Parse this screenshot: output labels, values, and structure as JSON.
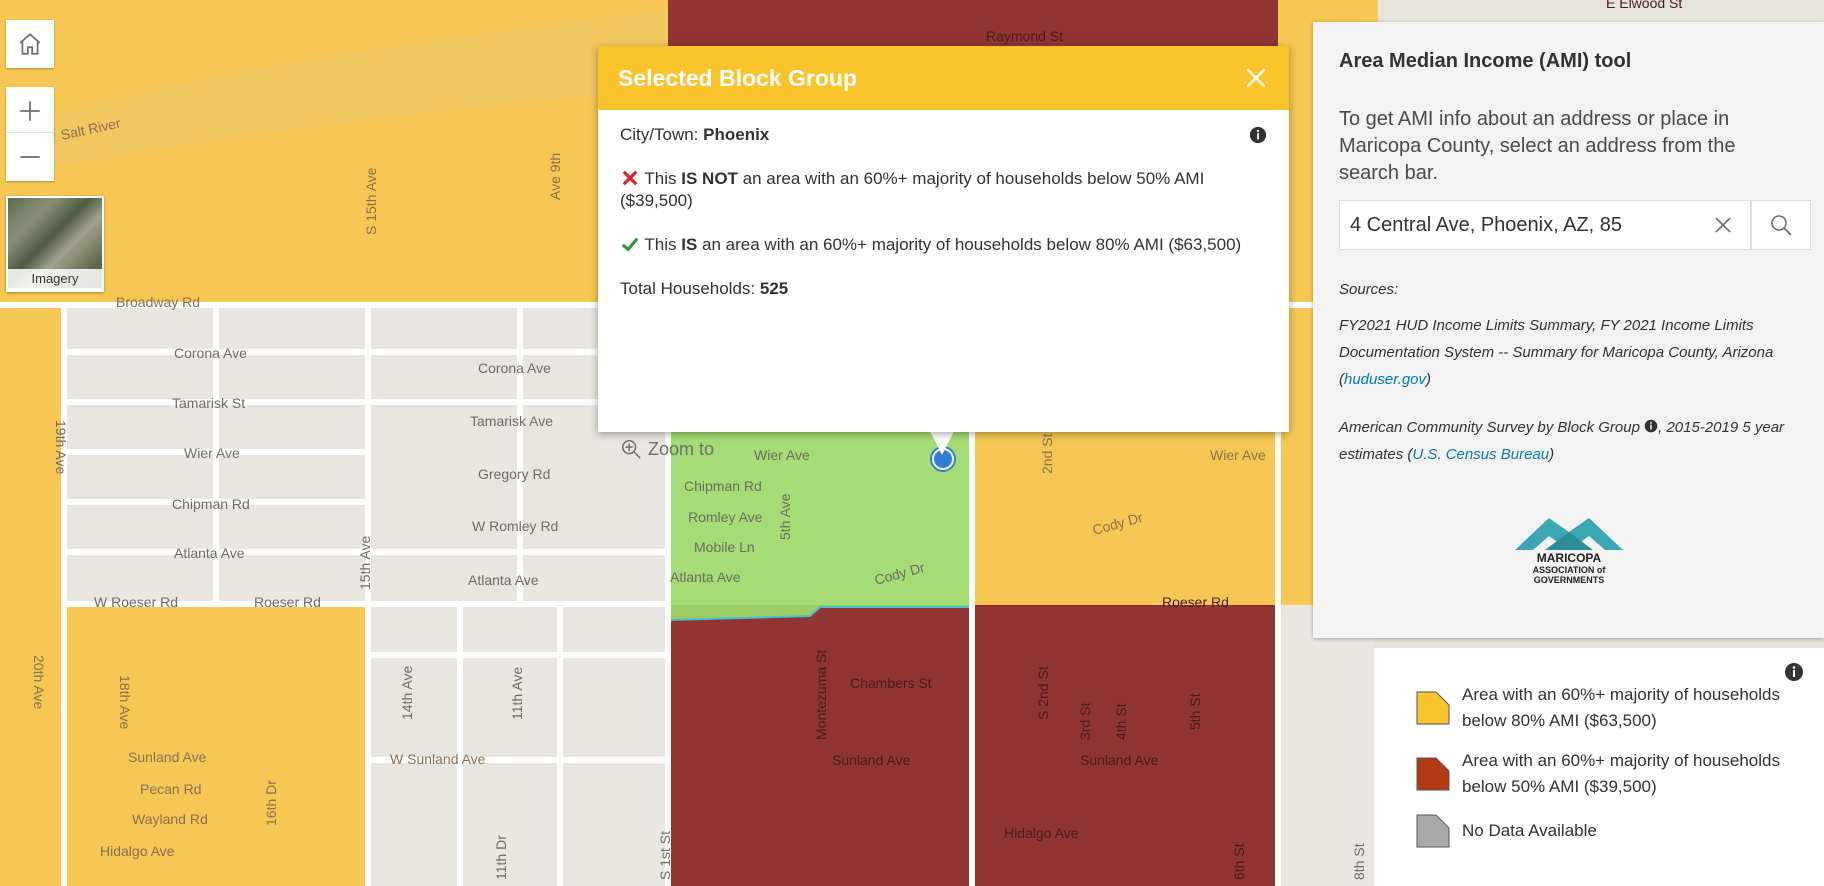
{
  "map": {
    "colors": {
      "yellow": "#f7c646",
      "red": "#8b2a2a",
      "green": "#9fdc6a",
      "road": "#ffffff",
      "base": "#e6e3de"
    },
    "street_labels": [
      "Salt River",
      "S 15th Ave",
      "Ave 9th",
      "Raymond St",
      "E Elwood St",
      "Broadway Rd",
      "Corona Ave",
      "Corona Ave",
      "Tamarisk St",
      "Tamarisk Ave",
      "Wier Ave",
      "Wier Ave",
      "Wier Ave",
      "Gregory Rd",
      "Chipman Rd",
      "Chipman Rd",
      "W Romley Rd",
      "Romley Ave",
      "Mobile Ln",
      "Atlanta Ave",
      "Atlanta Ave",
      "Atlanta Ave",
      "W Roeser Rd",
      "Roeser Rd",
      "Roeser Rd",
      "Cody Dr",
      "Cody Dr",
      "19th Ave",
      "15th Ave",
      "5th Ave",
      "2nd St",
      "Chambers St",
      "W Sunland Ave",
      "Sunland Ave",
      "Sunland Ave",
      "Sunland Ave",
      "Pecan Rd",
      "Wayland Rd",
      "Hidalgo Ave",
      "Hidalgo Ave",
      "18th Ave",
      "14th Ave",
      "11th Ave",
      "Montezuma St",
      "S 2nd St",
      "3rd St",
      "4th St",
      "5th St",
      "20th Ave",
      "16th Dr",
      "11th Dr",
      "8th St",
      "6th St",
      "S 1st St"
    ]
  },
  "controls": {
    "home": "home-icon",
    "zoom_in": "plus-icon",
    "zoom_out": "minus-icon",
    "basemap_label": "Imagery"
  },
  "popup": {
    "title": "Selected Block Group",
    "city_label": "City/Town: ",
    "city_value": "Phoenix",
    "line1_pre": "This ",
    "line1_emph": "IS NOT",
    "line1_post": " an area with an 60%+ majority of households below 50% AMI ($39,500)",
    "line2_pre": "This ",
    "line2_emph": "IS",
    "line2_post": " an area with an 60%+ majority of households below 80% AMI ($63,500)",
    "households_label": "Total Households: ",
    "households_value": "525",
    "zoom_to": "Zoom to"
  },
  "panel": {
    "title": "Area Median Income (AMI) tool",
    "description": "To get AMI info about an address or place in Maricopa County, select an address from the search bar.",
    "search_value": "4 Central Ave, Phoenix, AZ, 85",
    "sources_label": "Sources:",
    "source1_text": "FY2021 HUD Income Limits Summary, FY 2021 Income Limits Documentation System -- Summary for Maricopa County, Arizona (",
    "source1_link": "huduser.gov",
    "source1_end": ")",
    "source2_text": "American Community Survey by Block Group",
    "source2_text_b": ", 2015-2019 5 year estimates (",
    "source2_link": "U.S. Census Bureau",
    "source2_end": ")",
    "logo_line1": "MARICOPA",
    "logo_line2": "ASSOCIATION of",
    "logo_line3": "GOVERNMENTS"
  },
  "legend": {
    "items": [
      {
        "label": "Area with an 60%+ majority of households below 80% AMI ($63,500)",
        "color": "#f9c32a"
      },
      {
        "label": "Area with an 60%+ majority of households below 50% AMI ($39,500)",
        "color": "#b33a12"
      },
      {
        "label": "No Data Available",
        "color": "#a9a9a9"
      }
    ]
  }
}
